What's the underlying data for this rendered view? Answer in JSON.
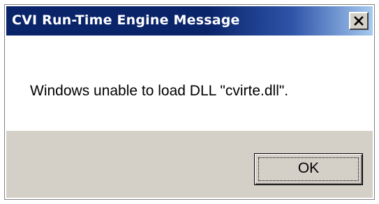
{
  "dialog": {
    "title": "CVI Run-Time Engine Message",
    "message": "Windows unable to load DLL \"cvirte.dll\".",
    "ok_label": "OK",
    "close_icon": "close-icon"
  },
  "colors": {
    "titlebar_start": "#0a246a",
    "titlebar_end": "#a6caf0",
    "button_face": "#d4d0c8",
    "content_background": "#ffffff"
  }
}
